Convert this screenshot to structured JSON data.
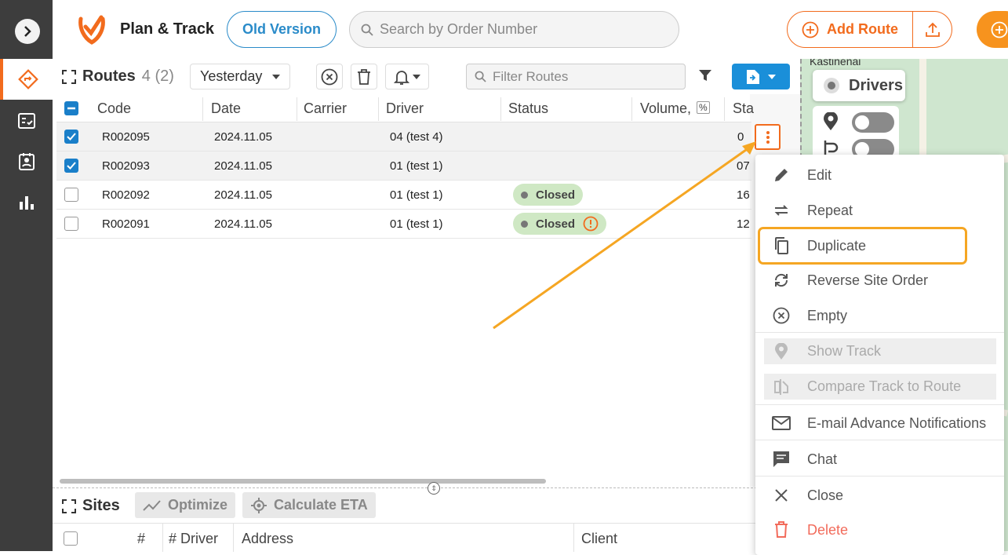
{
  "header": {
    "app_title": "Plan & Track",
    "old_version_label": "Old Version",
    "search_placeholder": "Search by Order Number",
    "add_route_label": "Add Route"
  },
  "routes": {
    "title": "Routes",
    "count": "4 (2)",
    "date_filter": "Yesterday",
    "filter_placeholder": "Filter Routes",
    "columns": [
      "Code",
      "Date",
      "Carrier",
      "Driver",
      "Status",
      "Volume,",
      "%",
      "Sta"
    ],
    "rows": [
      {
        "code": "R002095",
        "date": "2024.11.05",
        "carrier": "",
        "driver": "04 (test 4)",
        "status": "",
        "start": "0",
        "checked": true
      },
      {
        "code": "R002093",
        "date": "2024.11.05",
        "carrier": "",
        "driver": "01 (test 1)",
        "status": "",
        "start": "07",
        "checked": true
      },
      {
        "code": "R002092",
        "date": "2024.11.05",
        "carrier": "",
        "driver": "01 (test 1)",
        "status": "Closed",
        "start": "16",
        "checked": false
      },
      {
        "code": "R002091",
        "date": "2024.11.05",
        "carrier": "",
        "driver": "01 (test 1)",
        "status": "Closed",
        "start": "12",
        "checked": false
      }
    ]
  },
  "sites": {
    "title": "Sites",
    "optimize_label": "Optimize",
    "calculate_eta_label": "Calculate ETA",
    "columns": [
      "#",
      "# Driver",
      "Address",
      "Client"
    ]
  },
  "map": {
    "place_label": "Kastinenai",
    "drivers_label": "Drivers"
  },
  "context_menu": {
    "items": [
      {
        "label": "Edit",
        "icon": "pencil-icon",
        "enabled": true
      },
      {
        "label": "Repeat",
        "icon": "repeat-icon",
        "enabled": true
      },
      {
        "label": "Duplicate",
        "icon": "copy-icon",
        "enabled": true,
        "highlighted": true
      },
      {
        "label": "Reverse Site Order",
        "icon": "sync-icon",
        "enabled": true
      },
      {
        "label": "Empty",
        "icon": "circle-x-icon",
        "enabled": true
      },
      {
        "label": "Show Track",
        "icon": "pin-icon",
        "enabled": false
      },
      {
        "label": "Compare Track to Route",
        "icon": "compare-icon",
        "enabled": false
      },
      {
        "label": "E-mail Advance Notifications",
        "icon": "mail-icon",
        "enabled": true
      },
      {
        "label": "Chat",
        "icon": "chat-icon",
        "enabled": true
      },
      {
        "label": "Close",
        "icon": "x-icon",
        "enabled": true
      },
      {
        "label": "Delete",
        "icon": "trash-icon",
        "enabled": true,
        "danger": true
      }
    ]
  },
  "colors": {
    "accent_orange": "#f26b1d",
    "brand_blue": "#2a8bc9",
    "highlight": "#f5a623",
    "status_closed_bg": "#cfe8c4"
  }
}
